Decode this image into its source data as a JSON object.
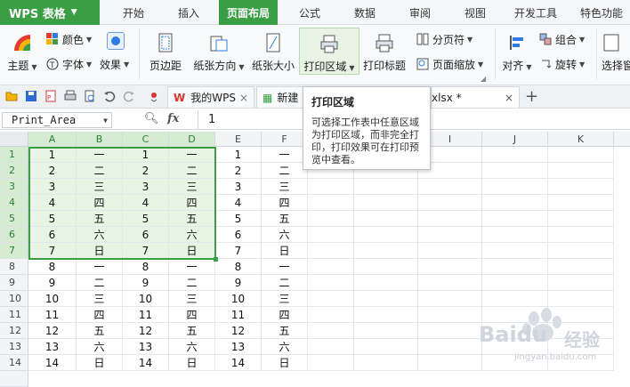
{
  "app": {
    "name": "WPS 表格"
  },
  "menu_tabs": [
    "开始",
    "插入",
    "页面布局",
    "公式",
    "数据",
    "审阅",
    "视图",
    "开发工具",
    "特色功能"
  ],
  "ribbon": {
    "theme": "主题",
    "color": "颜色",
    "font": "字体",
    "effect": "效果",
    "margins": "页边距",
    "orientation": "纸张方向",
    "paper_size": "纸张大小",
    "print_area": "打印区域",
    "print_titles": "打印标题",
    "page_break": "分页符",
    "page_zoom": "页面缩放",
    "align": "对齐",
    "group": "组合",
    "rotate": "旋转",
    "select_pane": "选择窗"
  },
  "doc_tabs": {
    "wps_tab": "我的WPS",
    "new_tab": "新建",
    "file_tab_suffix": "xlsx *"
  },
  "formula_bar": {
    "name_box": "Print_Area",
    "fx": "fx",
    "value": "1"
  },
  "tooltip": {
    "title": "打印区域",
    "body": "可选择工作表中任意区域为打印区域，而非完全打印，打印效果可在打印预览中查看。"
  },
  "columns": [
    "A",
    "B",
    "C",
    "D",
    "E",
    "F",
    "G",
    "H",
    "I",
    "J",
    "K"
  ],
  "rows": [
    [
      "1",
      "1",
      "一",
      "1",
      "一",
      "1",
      "一"
    ],
    [
      "2",
      "2",
      "二",
      "2",
      "二",
      "2",
      "二"
    ],
    [
      "3",
      "3",
      "三",
      "3",
      "三",
      "3",
      "三"
    ],
    [
      "4",
      "4",
      "四",
      "4",
      "四",
      "4",
      "四"
    ],
    [
      "5",
      "5",
      "五",
      "5",
      "五",
      "5",
      "五"
    ],
    [
      "6",
      "6",
      "六",
      "6",
      "六",
      "6",
      "六"
    ],
    [
      "7",
      "7",
      "日",
      "7",
      "日",
      "7",
      "日"
    ],
    [
      "8",
      "8",
      "一",
      "8",
      "一",
      "8",
      "一"
    ],
    [
      "9",
      "9",
      "二",
      "9",
      "二",
      "9",
      "二"
    ],
    [
      "10",
      "10",
      "三",
      "10",
      "三",
      "10",
      "三"
    ],
    [
      "11",
      "11",
      "四",
      "11",
      "四",
      "11",
      "四"
    ],
    [
      "12",
      "12",
      "五",
      "12",
      "五",
      "12",
      "五"
    ],
    [
      "13",
      "13",
      "六",
      "13",
      "六",
      "13",
      "六"
    ],
    [
      "14",
      "14",
      "日",
      "14",
      "日",
      "14",
      "日"
    ]
  ],
  "selection": {
    "range": "A1:D7"
  },
  "watermark": {
    "brand": "Baidu",
    "sub": "经验",
    "url": "jingyan.baidu.com"
  },
  "colors": {
    "accent": "#3a9e44",
    "selection_fill": "#e8f5e4",
    "header_selected": "#d6ecd2"
  }
}
